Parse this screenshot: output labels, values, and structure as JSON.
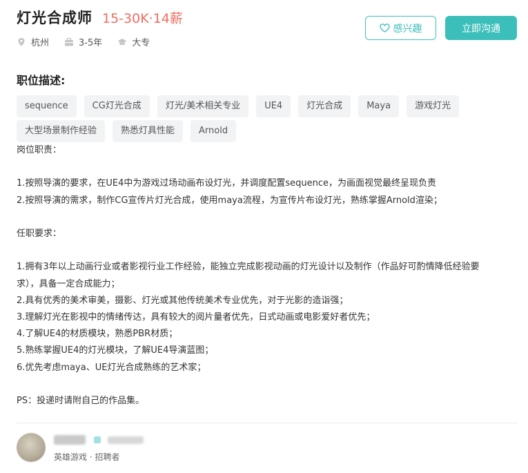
{
  "job": {
    "title": "灯光合成师",
    "salary": "15-30K·14薪",
    "location": "杭州",
    "experience": "3-5年",
    "education": "大专"
  },
  "actions": {
    "favorite_label": "感兴趣",
    "contact_label": "立即沟通"
  },
  "description": {
    "section_title": "职位描述:",
    "tags": [
      [
        "sequence",
        "CG灯光合成",
        "灯光/美术相关专业",
        "UE4",
        "灯光合成",
        "Maya",
        "游戏灯光"
      ],
      [
        "大型场景制作经验",
        "熟悉灯具性能",
        "Arnold"
      ]
    ],
    "lines": [
      "岗位职责：",
      "",
      "1.按照导演的要求，在UE4中为游戏过场动画布设灯光，并调度配置sequence，为画面视觉最终呈现负责",
      "2.按照导演的需求，制作CG宣传片灯光合成，使用maya流程，为宣传片布设灯光，熟练掌握Arnold渲染；",
      "",
      "任职要求：",
      "",
      "1.拥有3年以上动画行业或者影视行业工作经验，能独立完成影视动画的灯光设计以及制作（作品好可酌情降低经验要",
      "求），具备一定合成能力；",
      "2.具有优秀的美术审美，摄影、灯光或其他传统美术专业优先，对于光影的造诣强；",
      "3.理解灯光在影视中的情绪传达，具有较大的阅片量者优先，日式动画或电影爱好者优先；",
      "4.了解UE4的材质模块，熟悉PBR材质；",
      "5.熟练掌握UE4的灯光模块，了解UE4导演蓝图；",
      "6.优先考虑maya、UE灯光合成熟练的艺术家；",
      "",
      "PS：投递时请附自己的作品集。"
    ]
  },
  "recruiter": {
    "company_role": "英雄游戏 · 招聘者"
  },
  "colors": {
    "accent": "#3cbfba",
    "salary": "#f26d5f",
    "tag_bg": "#f2f3f5"
  },
  "icons": {
    "location": "location-pin-icon",
    "experience": "briefcase-icon",
    "education": "graduation-cap-icon",
    "favorite": "heart-icon"
  }
}
